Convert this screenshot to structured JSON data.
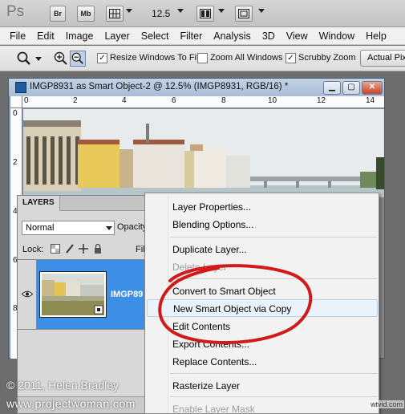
{
  "app": {
    "logo": "Ps",
    "bridge_label": "Br",
    "minibridge_label": "Mb",
    "zoom_level": "12.5"
  },
  "menu": [
    "File",
    "Edit",
    "Image",
    "Layer",
    "Select",
    "Filter",
    "Analysis",
    "3D",
    "View",
    "Window",
    "Help"
  ],
  "options": {
    "resize_windows": {
      "label": "Resize Windows To Fit",
      "checked": true
    },
    "zoom_all": {
      "label": "Zoom All Windows",
      "checked": false
    },
    "scrubby": {
      "label": "Scrubby Zoom",
      "checked": true
    },
    "actual_pixels": "Actual Pixe"
  },
  "document": {
    "title": "IMGP8931 as Smart Object-2 @ 12.5% (IMGP8931, RGB/16) *",
    "ruler_h": [
      "0",
      "2",
      "4",
      "6",
      "8",
      "10",
      "12",
      "14"
    ],
    "ruler_v": [
      "0",
      "2",
      "4",
      "6",
      "8"
    ]
  },
  "layers_panel": {
    "tab": "LAYERS",
    "blend_mode": "Normal",
    "opacity_label": "Opacity",
    "lock_label": "Lock:",
    "fill_label": "Fil",
    "layer_name": "IMGP89"
  },
  "context_menu": [
    {
      "label": "Layer Properties...",
      "disabled": false
    },
    {
      "label": "Blending Options...",
      "disabled": false
    },
    {
      "label": "Duplicate Layer...",
      "disabled": false
    },
    {
      "label": "Delete Layer",
      "disabled": true
    },
    {
      "label": "Convert to Smart Object",
      "disabled": false
    },
    {
      "label": "New Smart Object via Copy",
      "disabled": false,
      "highlighted": true
    },
    {
      "label": "Edit Contents",
      "disabled": false
    },
    {
      "label": "Export Contents...",
      "disabled": false
    },
    {
      "label": "Replace Contents...",
      "disabled": false
    },
    {
      "label": "Rasterize Layer",
      "disabled": false
    },
    {
      "label": "Enable Layer Mask",
      "disabled": true
    }
  ],
  "watermark": {
    "copyright": "© 2011, Helen Bradley",
    "site": "www.projectwoman.com",
    "tag": "wtvid.com"
  },
  "colors": {
    "selection_blue": "#3d8ee5",
    "annotation_red": "#d11a1a"
  }
}
